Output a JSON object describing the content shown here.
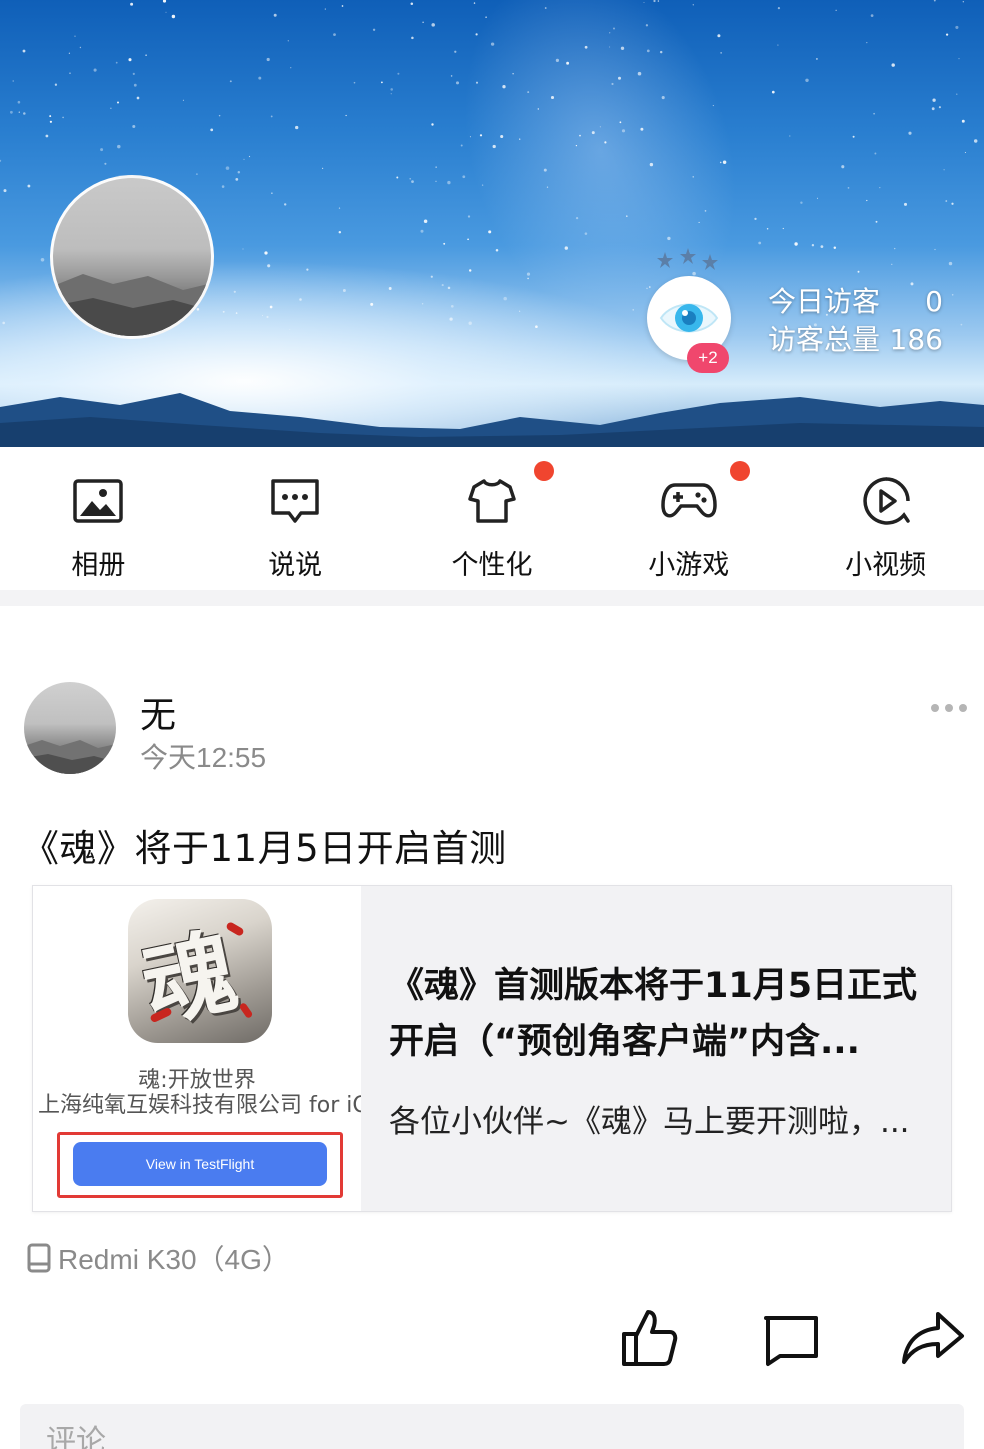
{
  "cover": {
    "visitors_today_label": "今日访客",
    "visitors_today_value": "0",
    "visitors_total_label": "访客总量",
    "visitors_total_value": "186",
    "visitor_badge": "+2",
    "visitor_icon": "eye-icon"
  },
  "nav": {
    "items": [
      {
        "label": "相册",
        "icon": "album-icon",
        "dot": false
      },
      {
        "label": "说说",
        "icon": "message-icon",
        "dot": false
      },
      {
        "label": "个性化",
        "icon": "tshirt-icon",
        "dot": true
      },
      {
        "label": "小游戏",
        "icon": "gamepad-icon",
        "dot": true
      },
      {
        "label": "小视频",
        "icon": "video-play-icon",
        "dot": false
      }
    ]
  },
  "post": {
    "author": "无",
    "time": "今天12:55",
    "text": "《魂》将于11月5日开启首测",
    "share": {
      "app_glyph": "魂",
      "app_name": "魂:开放世界",
      "app_company": "上海纯氧互娱科技有限公司 for iOS",
      "button_label": "View in TestFlight",
      "title": "《魂》首测版本将于11月5日正式开启（“预创角客户端”内含...",
      "description": "各位小伙伴~《魂》马上要开测啦，..."
    },
    "device": "Redmi K30（4G）",
    "comment_placeholder": "评论"
  },
  "colors": {
    "accent_red": "#f0452f",
    "badge_pink": "#f0476d",
    "testflight_blue": "#4a7cf0"
  }
}
